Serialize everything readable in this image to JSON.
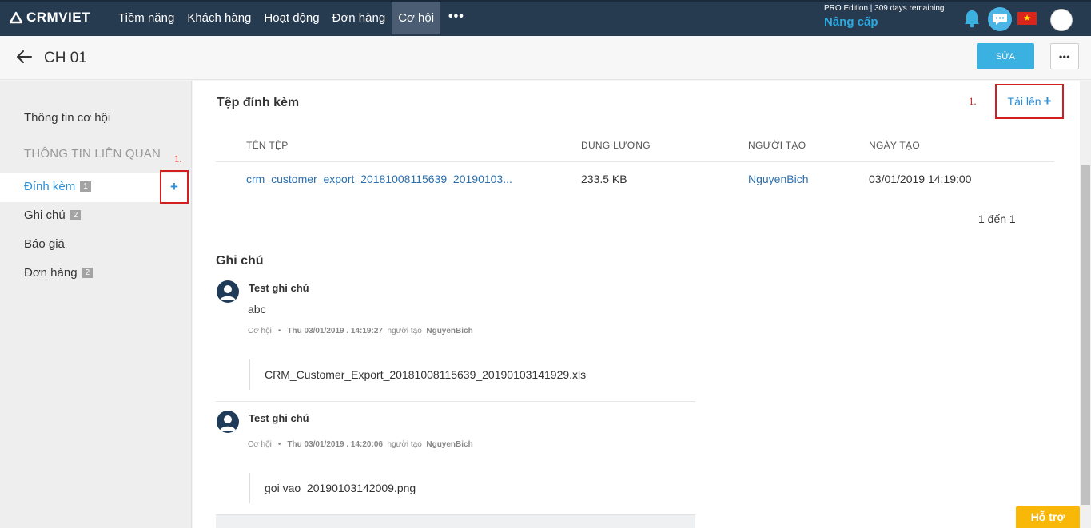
{
  "brand": {
    "name": "CRMVIET"
  },
  "nav": {
    "items": [
      "Tiềm năng",
      "Khách hàng",
      "Hoạt động",
      "Đơn hàng",
      "Cơ hội"
    ],
    "active_index": 4,
    "more": "•••"
  },
  "account": {
    "edition": "PRO Edition | 309 days remaining",
    "upgrade": "Nâng cấp"
  },
  "header": {
    "title": "CH 01",
    "edit_button": "SỬA",
    "more_button": "•••"
  },
  "sidebar": {
    "info": "Thông tin cơ hội",
    "section": "THÔNG TIN LIÊN QUAN",
    "items": [
      {
        "label": "Đính kèm",
        "badge": "1"
      },
      {
        "label": "Ghi chú",
        "badge": "2"
      },
      {
        "label": "Báo giá"
      },
      {
        "label": "Đơn hàng",
        "badge": "2"
      }
    ],
    "add_symbol": "+",
    "annotation": "1."
  },
  "attachments": {
    "heading": "Tệp đính kèm",
    "upload_label": "Tải lên",
    "upload_symbol": "+",
    "annotation": "1.",
    "columns": [
      "TÊN TỆP",
      "DUNG LƯỢNG",
      "NGƯỜI TẠO",
      "NGÀY TẠO"
    ],
    "rows": [
      {
        "name": "crm_customer_export_20181008115639_20190103...",
        "size": "233.5 KB",
        "creator": "NguyenBich",
        "date": "03/01/2019 14:19:00"
      }
    ],
    "pager": "1 đến 1"
  },
  "notes": {
    "heading": "Ghi chú",
    "items": [
      {
        "title": "Test ghi chú",
        "body": "abc",
        "category": "Cơ hội",
        "time": "Thu 03/01/2019 . 14:19:27",
        "by_label": "người tạo",
        "author": "NguyenBich",
        "file": "CRM_Customer_Export_20181008115639_20190103141929.xls"
      },
      {
        "title": "Test ghi chú",
        "body": "",
        "category": "Cơ hội",
        "time": "Thu 03/01/2019 . 14:20:06",
        "by_label": "người tạo",
        "author": "NguyenBich",
        "file": "goi vao_20190103142009.png"
      }
    ]
  },
  "support": {
    "label": "Hỗ trợ"
  },
  "colors": {
    "nav_bg": "#263a50",
    "accent": "#3bb1e2",
    "link": "#2b6fae",
    "highlight": "#d31f1f",
    "support": "#f9b707"
  }
}
